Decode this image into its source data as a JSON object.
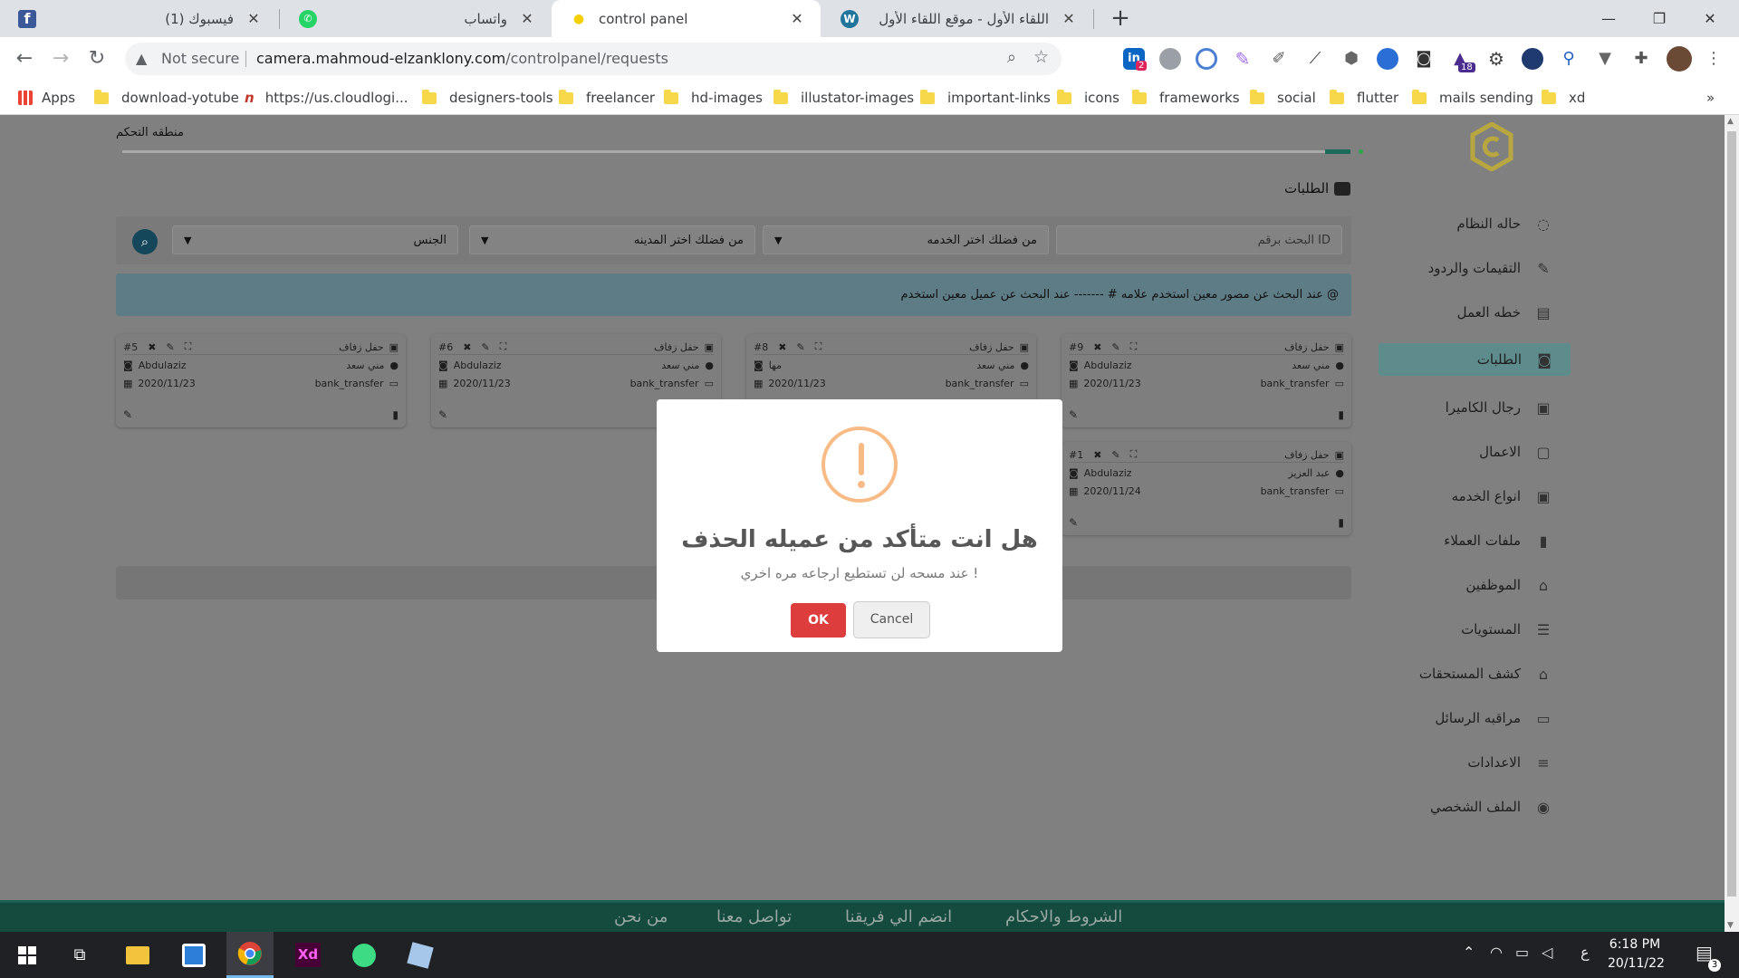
{
  "browser": {
    "tabs": [
      {
        "title": "(1) فيسبوك",
        "favicon": "facebook-icon",
        "active": false
      },
      {
        "title": "واتساب",
        "favicon": "whatsapp-icon",
        "active": false
      },
      {
        "title": "control panel",
        "favicon": "bulb-icon",
        "active": true
      },
      {
        "title": "اللقاء الأول - موقع اللقاء الأول",
        "favicon": "wordpress-icon",
        "active": false
      }
    ],
    "security_label": "Not secure",
    "url_host": "camera.mahmoud-elzanklony.com",
    "url_path": "/controlpanel/requests",
    "extension_badges": {
      "linkedin": "2",
      "graduation": "18"
    },
    "bookmarks": [
      "Apps",
      "download-yotube",
      "https://us.cloudlogi...",
      "designers-tools",
      "freelancer",
      "hd-images",
      "illustator-images",
      "important-links",
      "icons",
      "frameworks",
      "social",
      "flutter",
      "mails sending",
      "xd"
    ],
    "more_bookmarks": "»"
  },
  "page": {
    "breadcrumb": "منطقه التحكم",
    "section_title": "الطلبات",
    "filters": {
      "id_search_placeholder": "البحث برقم ID",
      "service_select": "من فضلك اختر الخدمه",
      "city_select": "من فضلك اختر المدينه",
      "gender_select": "الجنس"
    },
    "note": "عند البحث عن مصور معين استخدم علامه # ------- عند البحث عن عميل معين استخدم @",
    "cards": [
      {
        "id": "#9",
        "type": "حفل زفاف",
        "user": "مني سعد",
        "photographer": "Abdulaziz",
        "payment": "bank_transfer",
        "date": "2020/11/23"
      },
      {
        "id": "#8",
        "type": "حفل زفاف",
        "user": "مني سعد",
        "photographer": "مها",
        "payment": "bank_transfer",
        "date": "2020/11/23"
      },
      {
        "id": "#6",
        "type": "حفل زفاف",
        "user": "مني سعد",
        "photographer": "Abdulaziz",
        "payment": "bank_transfer",
        "date": "2020/11/23"
      },
      {
        "id": "#5",
        "type": "حفل زفاف",
        "user": "مني سعد",
        "photographer": "Abdulaziz",
        "payment": "bank_transfer",
        "date": "2020/11/23"
      },
      {
        "id": "#1",
        "type": "حفل زفاف",
        "user": "عبد العزيز",
        "photographer": "Abdulaziz",
        "payment": "bank_transfer",
        "date": "2020/11/24"
      }
    ]
  },
  "sidebar": {
    "items": [
      {
        "label": "حاله النظام",
        "icon": "spinner-icon"
      },
      {
        "label": "التقيمات والردود",
        "icon": "edit-square-icon"
      },
      {
        "label": "خطه العمل",
        "icon": "plan-icon"
      },
      {
        "label": "الطلبات",
        "icon": "camera-icon",
        "active": true
      },
      {
        "label": "رجال الكاميرا",
        "icon": "contact-book-icon"
      },
      {
        "label": "الاعمال",
        "icon": "calendar-icon"
      },
      {
        "label": "انواع الخدمه",
        "icon": "briefcase-icon"
      },
      {
        "label": "ملفات العملاء",
        "icon": "trash-bin-icon"
      },
      {
        "label": "الموظفين",
        "icon": "id-card-icon"
      },
      {
        "label": "المستويات",
        "icon": "layers-icon"
      },
      {
        "label": "كشف المستحقات",
        "icon": "bank-icon"
      },
      {
        "label": "مراقبه الرسائل",
        "icon": "message-icon"
      },
      {
        "label": "الاعدادات",
        "icon": "sliders-icon"
      },
      {
        "label": "الملف الشخصي",
        "icon": "user-circle-icon"
      }
    ]
  },
  "footer": {
    "links": [
      "الشروط والاحكام",
      "انضم الي فريقنا",
      "تواصل معنا",
      "من نحن"
    ]
  },
  "modal": {
    "title": "هل انت متأكد من عميله الحذف",
    "text": "عند مسحه لن تستطيع ارجاعه مره اخري !",
    "ok_label": "OK",
    "cancel_label": "Cancel"
  },
  "taskbar": {
    "lang": "ع",
    "time": "6:18 PM",
    "date": "20/11/22",
    "notification_count": "3"
  },
  "colors": {
    "accent_teal": "#5e8c8d",
    "footer_green": "#154a3f",
    "ok_red": "#dd3d3d",
    "warning_orange": "#f8bb86"
  }
}
